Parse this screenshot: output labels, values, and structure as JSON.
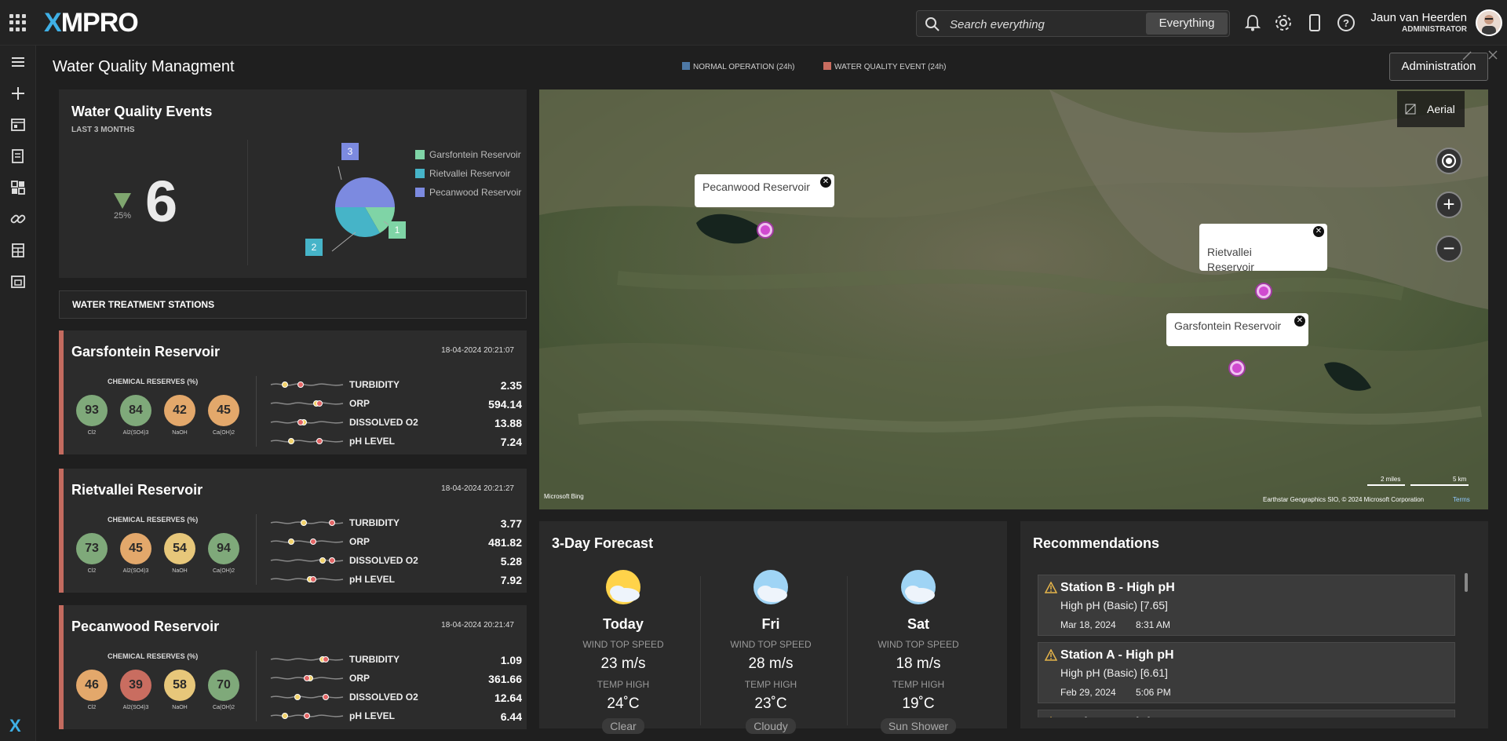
{
  "header": {
    "logo": "XMPRO",
    "search_placeholder": "Search everything",
    "search_scope": "Everything",
    "user_name": "Jaun van Heerden",
    "user_role": "ADMINISTRATOR"
  },
  "page": {
    "title": "Water Quality Managment",
    "legend_normal": "NORMAL OPERATION (24h)",
    "legend_event": "WATER QUALITY EVENT (24h)",
    "admin_button": "Administration"
  },
  "events": {
    "title": "Water Quality Events",
    "subtitle": "LAST 3 MONTHS",
    "total": "6",
    "change": "25%",
    "legend": [
      "Garsfontein Reservoir",
      "Rietvallei Reservoir",
      "Pecanwood Reservoir"
    ],
    "callouts": [
      "3",
      "1",
      "2"
    ]
  },
  "chart_data": {
    "type": "pie",
    "categories": [
      "Garsfontein Reservoir",
      "Rietvallei Reservoir",
      "Pecanwood Reservoir"
    ],
    "values": [
      1,
      2,
      3
    ],
    "colors": [
      "#7fd4a6",
      "#46b4c8",
      "#7c8ae0"
    ]
  },
  "stations_header": "WATER TREATMENT STATIONS",
  "stations": [
    {
      "name": "Garsfontein Reservoir",
      "timestamp": "18-04-2024 20:21:07",
      "chem_title": "CHEMICAL RESERVES (%)",
      "chems": [
        {
          "label": "Cl2",
          "value": "93",
          "color": "#7fa97a"
        },
        {
          "label": "Al2(SO4)3",
          "value": "84",
          "color": "#7fa97a"
        },
        {
          "label": "NaOH",
          "value": "42",
          "color": "#e3a86b"
        },
        {
          "label": "Ca(OH)2",
          "value": "45",
          "color": "#e3a86b"
        }
      ],
      "metrics": [
        {
          "label": "TURBIDITY",
          "value": "2.35"
        },
        {
          "label": "ORP",
          "value": "594.14"
        },
        {
          "label": "DISSOLVED O2",
          "value": "13.88"
        },
        {
          "label": "pH LEVEL",
          "value": "7.24"
        }
      ]
    },
    {
      "name": "Rietvallei Reservoir",
      "timestamp": "18-04-2024 20:21:27",
      "chem_title": "CHEMICAL RESERVES (%)",
      "chems": [
        {
          "label": "Cl2",
          "value": "73",
          "color": "#7fa97a"
        },
        {
          "label": "Al2(SO4)3",
          "value": "45",
          "color": "#e3a86b"
        },
        {
          "label": "NaOH",
          "value": "54",
          "color": "#e7c77a"
        },
        {
          "label": "Ca(OH)2",
          "value": "94",
          "color": "#7fa97a"
        }
      ],
      "metrics": [
        {
          "label": "TURBIDITY",
          "value": "3.77"
        },
        {
          "label": "ORP",
          "value": "481.82"
        },
        {
          "label": "DISSOLVED O2",
          "value": "5.28"
        },
        {
          "label": "pH LEVEL",
          "value": "7.92"
        }
      ]
    },
    {
      "name": "Pecanwood Reservoir",
      "timestamp": "18-04-2024 20:21:47",
      "chem_title": "CHEMICAL RESERVES (%)",
      "chems": [
        {
          "label": "Cl2",
          "value": "46",
          "color": "#e3a86b"
        },
        {
          "label": "Al2(SO4)3",
          "value": "39",
          "color": "#c96d60"
        },
        {
          "label": "NaOH",
          "value": "58",
          "color": "#e7c77a"
        },
        {
          "label": "Ca(OH)2",
          "value": "70",
          "color": "#7fa97a"
        }
      ],
      "metrics": [
        {
          "label": "TURBIDITY",
          "value": "1.09"
        },
        {
          "label": "ORP",
          "value": "361.66"
        },
        {
          "label": "DISSOLVED O2",
          "value": "12.64"
        },
        {
          "label": "pH LEVEL",
          "value": "6.44"
        }
      ]
    }
  ],
  "map": {
    "aerial_label": "Aerial",
    "popups": [
      "Pecanwood Reservoir",
      "Rietvallei\nReservoir",
      "Garsfontein Reservoir"
    ],
    "attribution_left": "Microsoft Bing",
    "attribution_right": "Earthstar Geographics SIO, © 2024 Microsoft Corporation",
    "terms": "Terms",
    "scale_mi": "2 miles",
    "scale_km": "5 km"
  },
  "forecast": {
    "title": "3-Day Forecast",
    "wind_label": "WIND TOP SPEED",
    "temp_label": "TEMP HIGH",
    "days": [
      {
        "day": "Today",
        "wind": "23 m/s",
        "temp": "24˚C",
        "cond": "Clear"
      },
      {
        "day": "Fri",
        "wind": "28 m/s",
        "temp": "23˚C",
        "cond": "Cloudy"
      },
      {
        "day": "Sat",
        "wind": "18 m/s",
        "temp": "19˚C",
        "cond": "Sun Shower"
      }
    ]
  },
  "recommendations": {
    "title": "Recommendations",
    "items": [
      {
        "title": "Station B - High pH",
        "detail": "High pH (Basic) [7.65]",
        "date": "Mar 18, 2024",
        "time": "8:31 AM"
      },
      {
        "title": "Station A - High pH",
        "detail": "High pH (Basic) [6.61]",
        "date": "Feb 29, 2024",
        "time": "5:06 PM"
      },
      {
        "title": "Station C - High pH",
        "detail": "",
        "date": "",
        "time": ""
      }
    ]
  }
}
